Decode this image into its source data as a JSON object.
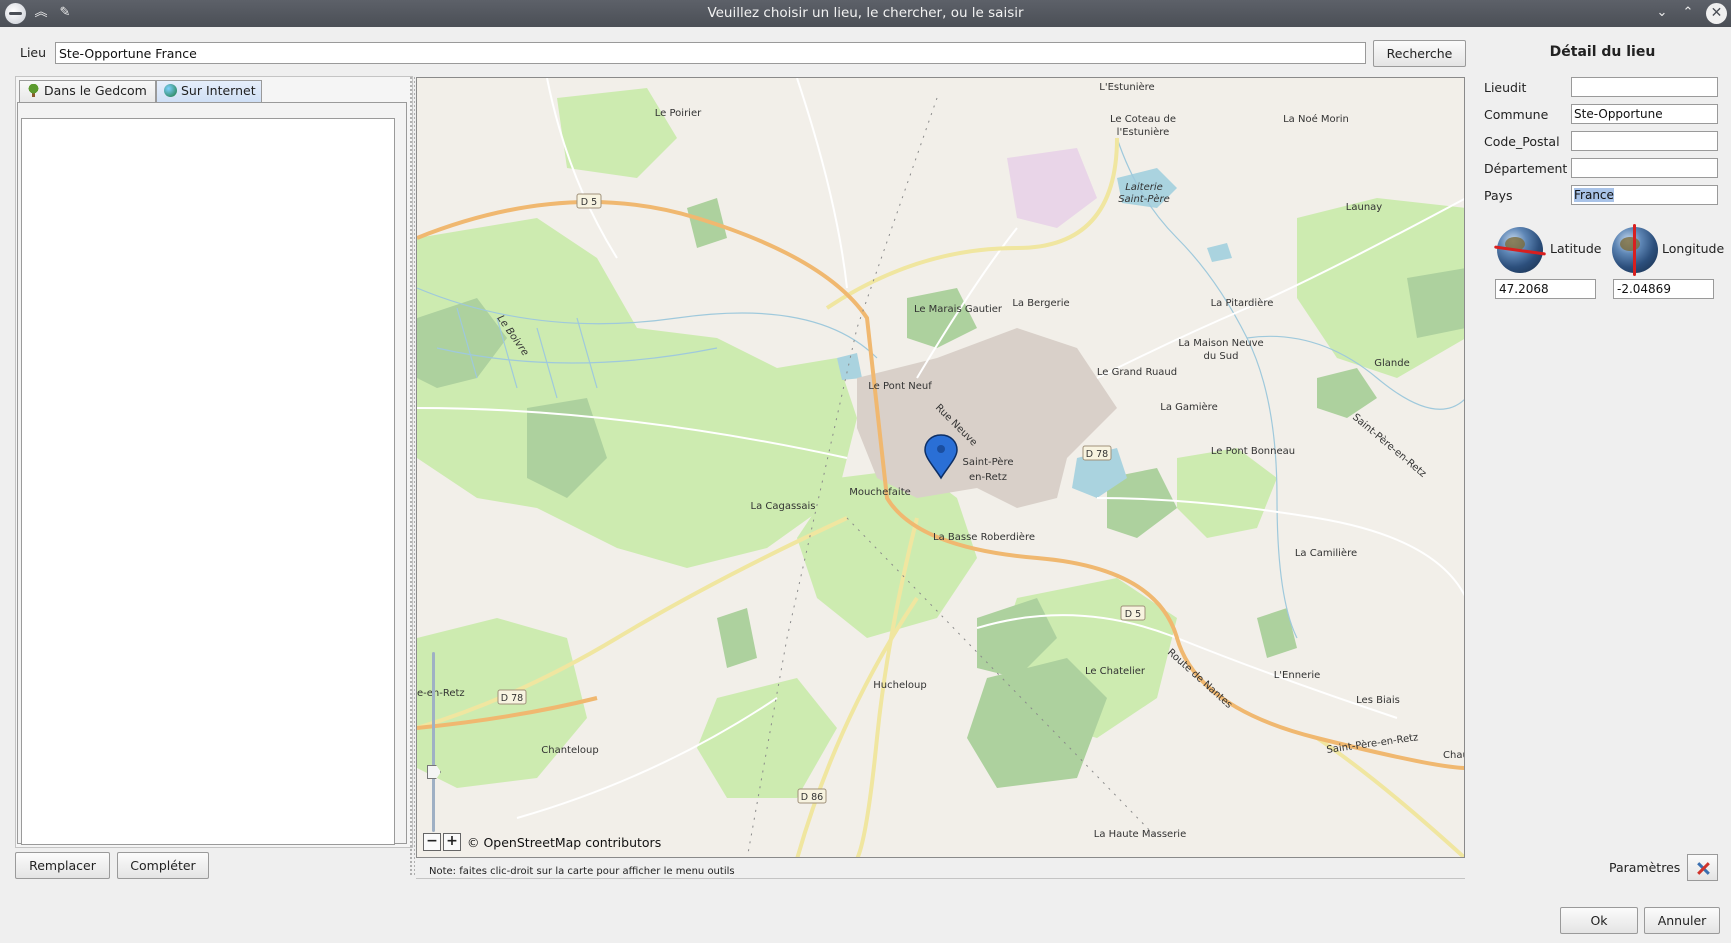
{
  "window": {
    "title": "Veuillez choisir un lieu, le chercher, ou le saisir",
    "icons": [
      "app-logo-icon",
      "chevrons-up-icon",
      "pin-icon",
      "chevron-down-icon",
      "chevron-up-icon",
      "close-icon"
    ]
  },
  "search": {
    "label": "Lieu",
    "value": "Ste-Opportune France",
    "button": "Recherche"
  },
  "tabs": [
    {
      "label": "Dans le Gedcom",
      "icon": "tree-icon"
    },
    {
      "label": "Sur Internet",
      "icon": "globe-icon",
      "active": true
    }
  ],
  "left_buttons": {
    "replace": "Remplacer",
    "complete": "Compléter"
  },
  "map": {
    "attribution": "© OpenStreetMap contributors",
    "zoom_out": "−",
    "zoom_in": "+",
    "zoom_level_fraction": 0.68,
    "note": "Note: faites clic-droit sur la carte pour afficher le menu outils",
    "places": [
      "L'Estunière",
      "Le Poirier",
      "Le Coteau de",
      "l'Estunière",
      "La Noé Morin",
      "Laiterie",
      "Saint-Père",
      "Launay",
      "Le Marais Gautier",
      "La Bergerie",
      "La Pitardière",
      "Le Pont Neuf",
      "Le Grand Ruaud",
      "La Maison Neuve",
      "du Sud",
      "Glande",
      "La Gamière",
      "Saint-Père",
      "en-Retz",
      "Le Pont Bonneau",
      "Mouchefaite",
      "La Cagassais",
      "La Basse Roberdière",
      "La Camilière",
      "Le Chatelier",
      "L'Ennerie",
      "Les Biais",
      "Hucheloup",
      "Chanteloup",
      "La Haute Masserie",
      "Le Boivre",
      "Rue Neuve",
      "Route de Nantes",
      "Saint-Père-en-Retz",
      "Saint-Père-en-Retz",
      "e-en-Retz",
      "Chau"
    ],
    "roads": [
      "D 5",
      "D 78",
      "D 5",
      "D 78",
      "D 86"
    ],
    "colors": {
      "background": "#f2efe9",
      "meadow": "#cdebb0",
      "forest": "#add19e",
      "water": "#aad3df",
      "primary_road": "#fcd6a4",
      "secondary_road": "#f7fabf",
      "urban": "#d9d0c9",
      "marker": "#2a6fd6"
    }
  },
  "detail": {
    "title": "Détail du lieu",
    "fields": [
      {
        "label": "Lieudit",
        "value": ""
      },
      {
        "label": "Commune",
        "value": "Ste-Opportune"
      },
      {
        "label": "Code_Postal",
        "value": ""
      },
      {
        "label": "Département",
        "value": ""
      },
      {
        "label": "Pays",
        "value": "France"
      }
    ],
    "latitude_label": "Latitude",
    "longitude_label": "Longitude",
    "latitude": "47.2068",
    "longitude": "-2.04869"
  },
  "footer": {
    "params_label": "Paramètres",
    "ok": "Ok",
    "cancel": "Annuler"
  }
}
